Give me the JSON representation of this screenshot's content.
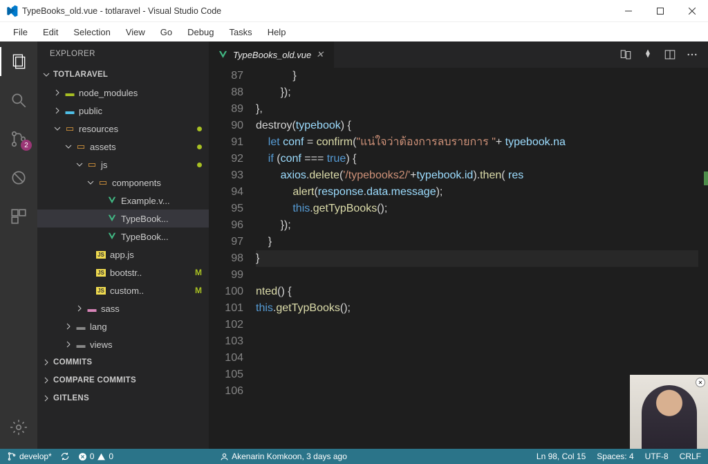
{
  "title": "TypeBooks_old.vue - totlaravel - Visual Studio Code",
  "menu": [
    "File",
    "Edit",
    "Selection",
    "View",
    "Go",
    "Debug",
    "Tasks",
    "Help"
  ],
  "activity_badge": "2",
  "explorer_title": "EXPLORER",
  "project_section": "TOTLARAVEL",
  "tree": {
    "node_modules": "node_modules",
    "public": "public",
    "resources": "resources",
    "assets": "assets",
    "js": "js",
    "components": "components",
    "example": "Example.v...",
    "typebook1": "TypeBook...",
    "typebook2": "TypeBook...",
    "appjs": "app.js",
    "bootstr": "bootstr..",
    "custom": "custom..",
    "sass": "sass",
    "lang": "lang",
    "views": "views"
  },
  "m_label": "M",
  "sections": {
    "commits": "COMMITS",
    "compare": "COMPARE COMMITS",
    "gitlens": "GITLENS"
  },
  "tab": {
    "name": "TypeBooks_old.vue"
  },
  "gutter_start": 87,
  "code_lines": [
    "            }",
    "        });",
    "},",
    "destroy(<span class='tk-var'>typebook</span>) {",
    "    <span class='tk-key'>let</span> <span class='tk-var'>conf</span> = <span class='tk-fn'>confirm</span>(<span class='tk-str'>\"แน่ใจว่าต้องการลบรายการ \"</span>+ <span class='tk-var'>typebook</span>.<span class='tk-mem'>na</span>",
    "    <span class='tk-key'>if</span> (<span class='tk-var'>conf</span> === <span class='tk-const'>true</span>) {",
    "        <span class='tk-var'>axios</span>.<span class='tk-fn'>delete</span>(<span class='tk-str'>'/typebooks2/'</span>+<span class='tk-var'>typebook</span>.<span class='tk-mem'>id</span>).<span class='tk-fn'>then</span>( <span class='tk-var'>res</span>",
    "            <span class='tk-fn'>alert</span>(<span class='tk-var'>response</span>.<span class='tk-mem'>data</span>.<span class='tk-mem'>message</span>);",
    "            <span class='tk-const'>this</span>.<span class='tk-fn'>getTypBooks</span>();",
    "        });",
    "    }",
    "}",
    "",
    "<span class='tk-fn'>nted</span>() {",
    "<span class='tk-const'>this</span>.<span class='tk-fn'>getTypBooks</span>();",
    "",
    "",
    "",
    "",
    ""
  ],
  "highlight_index": 11,
  "status": {
    "branch": "develop*",
    "errors": "0",
    "warnings": "0",
    "blame": "Akenarin Komkoon, 3 days ago",
    "position": "Ln 98, Col 15",
    "spaces": "Spaces: 4",
    "encoding": "UTF-8",
    "eol": "CRLF"
  }
}
